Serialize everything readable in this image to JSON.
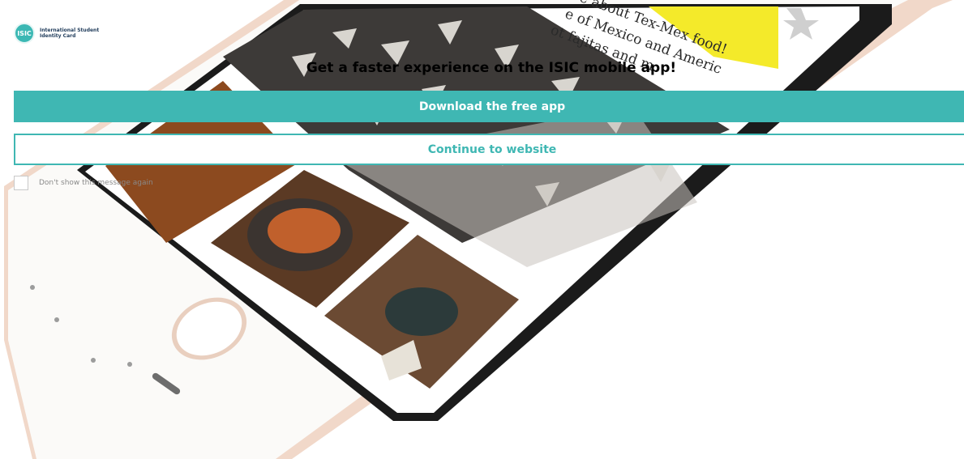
{
  "logo": {
    "mark": "ISIC",
    "line1": "International Student",
    "line2": "Identity Card"
  },
  "headline": "Get a faster experience on the ISIC mobile app!",
  "buttons": {
    "download_label": "Download the free app",
    "continue_label": "Continue to website"
  },
  "checkbox": {
    "label": "Don't show this message again",
    "checked": false
  },
  "background": {
    "screen_text": [
      "e about Tex-Mex food!",
      "e of Mexico and Americ",
      "ot fajitas and m"
    ]
  },
  "colors": {
    "accent": "#3fb7b3",
    "phone_gold": "#efd4c4",
    "highlight_yellow": "#f4ea2a"
  }
}
